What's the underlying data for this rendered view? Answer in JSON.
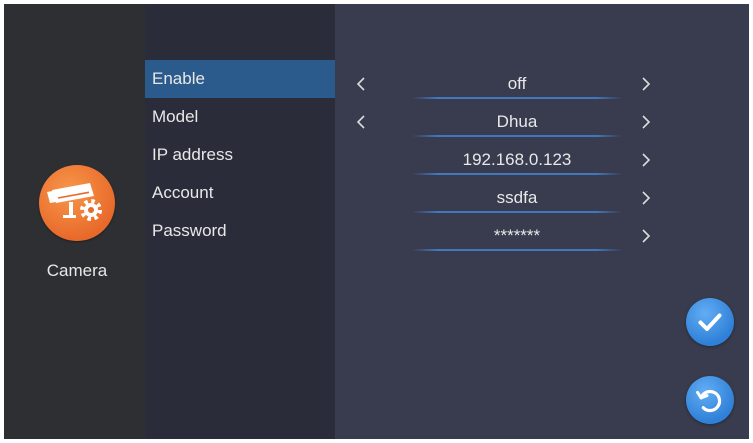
{
  "colors": {
    "sidebar_bg": "#2e2f33",
    "menu_bg": "#2a2d39",
    "content_bg": "#383c4e",
    "highlight": "#2b5a8d",
    "accent_orange": "#e8692a",
    "accent_blue": "#2f80d8",
    "text": "#e8e8e8"
  },
  "sidebar": {
    "icon": "cctv-camera-gear-icon",
    "label": "Camera"
  },
  "menu": {
    "items": [
      {
        "label": "Enable",
        "selected": true
      },
      {
        "label": "Model",
        "selected": false
      },
      {
        "label": "IP address",
        "selected": false
      },
      {
        "label": "Account",
        "selected": false
      },
      {
        "label": "Password",
        "selected": false
      }
    ]
  },
  "settings": [
    {
      "value": "off",
      "prev_icon": "chevron-left-icon",
      "next_icon": "chevron-right-icon"
    },
    {
      "value": "Dhua",
      "prev_icon": "chevron-left-icon",
      "next_icon": "chevron-right-icon"
    },
    {
      "value": "192.168.0.123",
      "prev_icon": null,
      "next_icon": "chevron-right-icon"
    },
    {
      "value": "ssdfa",
      "prev_icon": null,
      "next_icon": "chevron-right-icon"
    },
    {
      "value": "*******",
      "prev_icon": null,
      "next_icon": "chevron-right-icon"
    }
  ],
  "actions": {
    "confirm_icon": "check-icon",
    "reset_icon": "refresh-icon"
  }
}
